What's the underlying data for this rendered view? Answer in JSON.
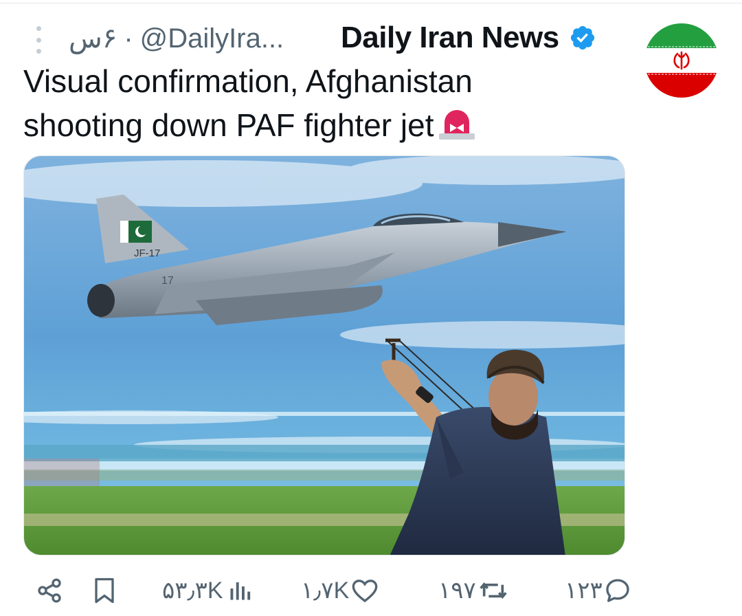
{
  "header": {
    "display_name": "Daily Iran News",
    "handle": "@DailyIra...",
    "separator": "·",
    "time_ago": "۶س",
    "verified_icon": "verified-badge-icon",
    "more_icon": "more-vertical-icon"
  },
  "avatar": {
    "icon": "iran-flag-avatar"
  },
  "tweet": {
    "text": "Visual confirmation, Afghanistan shooting down PAF fighter jet",
    "emoji_icon": "police-light-icon"
  },
  "media": {
    "icon": "photo-fighter-jet-slingshot",
    "jet_label": "JF-17",
    "tail_number": "17"
  },
  "actions": {
    "share_icon": "share-icon",
    "bookmark_icon": "bookmark-icon",
    "views": "۵۳٫۳K",
    "likes": "۱٫۷K",
    "reposts": "۱۹۷",
    "replies": "۱۲۳"
  },
  "colors": {
    "accent_blue": "#1d9bf0",
    "text_primary": "#0f1419",
    "text_secondary": "#536471",
    "alarm_red": "#e0245e"
  }
}
